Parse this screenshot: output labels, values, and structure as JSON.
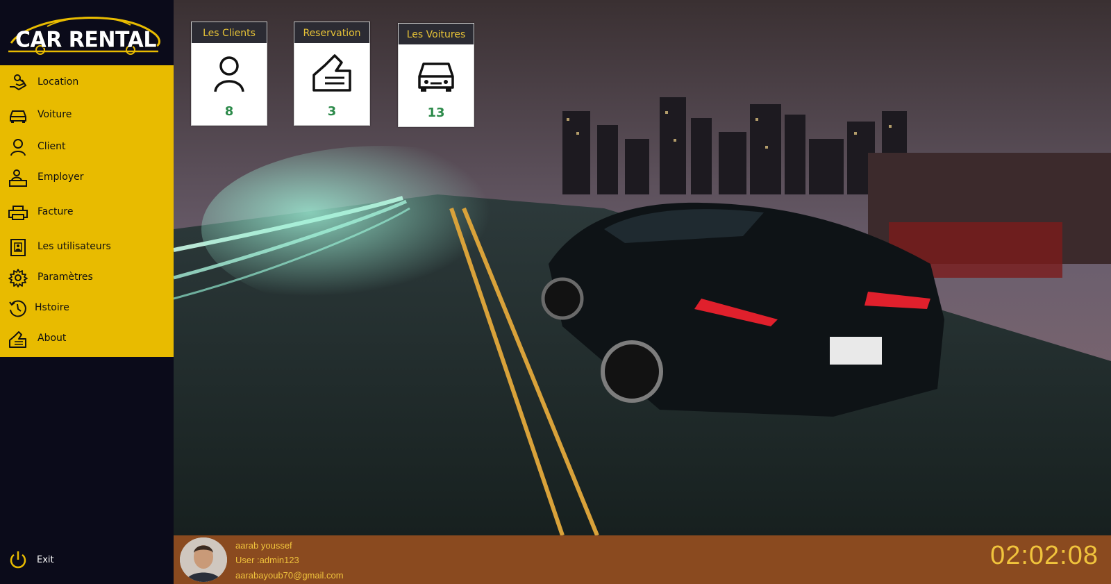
{
  "app": {
    "logo_text": "CAR RENTAL"
  },
  "sidebar": {
    "items": [
      {
        "label": "Location",
        "icon": "hand-key-icon"
      },
      {
        "label": "Voiture",
        "icon": "car-icon"
      },
      {
        "label": "Client",
        "icon": "person-icon"
      },
      {
        "label": "Employer",
        "icon": "employee-desk-icon"
      },
      {
        "label": "Facture",
        "icon": "printer-icon"
      },
      {
        "label": "Les utilisateurs",
        "icon": "user-badge-icon"
      },
      {
        "label": "Paramètres",
        "icon": "gear-icon"
      },
      {
        "label": "Hstoire",
        "icon": "history-clock-icon"
      },
      {
        "label": "About",
        "icon": "about-hand-icon"
      }
    ],
    "exit_label": "Exit"
  },
  "stats": [
    {
      "title": "Les Clients",
      "value": "8",
      "icon": "person-icon"
    },
    {
      "title": "Reservation",
      "value": "3",
      "icon": "reservation-hand-icon"
    },
    {
      "title": "Les Voitures",
      "value": "13",
      "icon": "car-front-icon"
    }
  ],
  "footer": {
    "name": "aarab  youssef",
    "user": "User :admin123",
    "email": "aarabayoub70@gmail.com",
    "time": "02:02:08"
  },
  "colors": {
    "sidebar_bg": "#0b0b1a",
    "nav_bg": "#e8bb00",
    "footer_bg": "#8a4a1f",
    "accent_text": "#f0c33c",
    "stat_value": "#2c8a4a"
  }
}
